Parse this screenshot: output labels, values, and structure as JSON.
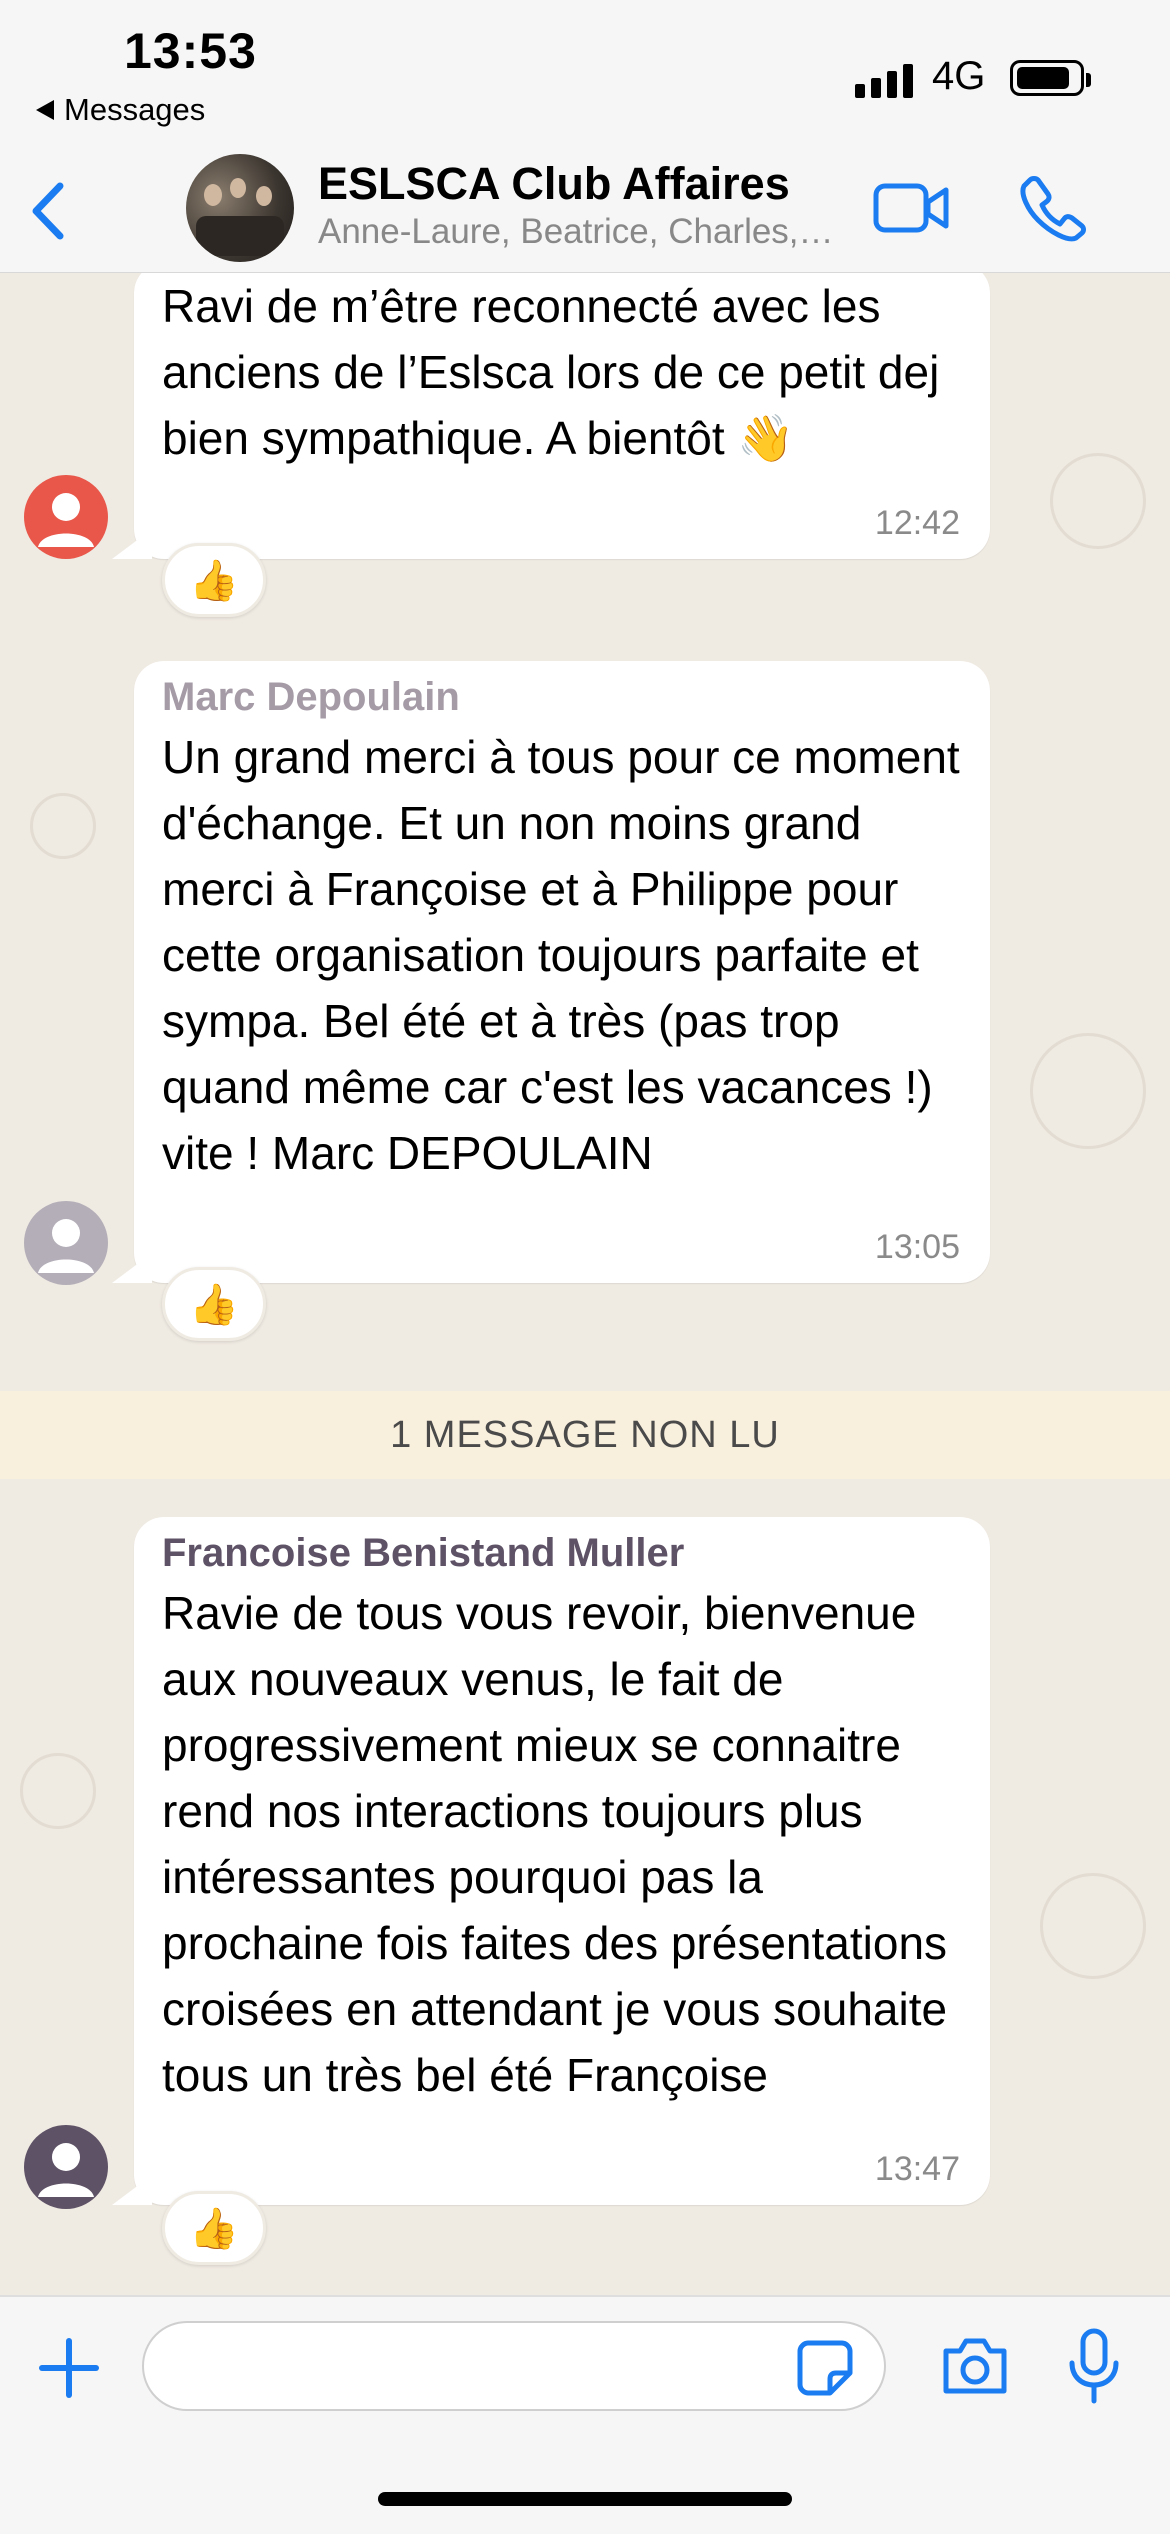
{
  "status_bar": {
    "time": "13:53",
    "back_app": "Messages",
    "network": "4G",
    "battery_level": 0.86
  },
  "header": {
    "group_name": "ESLSCA Club Affaires",
    "members": "Anne-Laure, Beatrice, Charles, Marc, Philippe",
    "back_icon": "chevron-left-icon",
    "video_icon": "video-camera-icon",
    "call_icon": "phone-icon",
    "accent_color": "#1a7cf0"
  },
  "messages": [
    {
      "sender": "",
      "text": "Ravi de m’être reconnecté avec les anciens de l’Eslsca lors de ce petit dej bien sympathique. A bientôt 👋",
      "time": "12:42",
      "reaction": "👍",
      "avatar_color": "#e8574a"
    },
    {
      "sender": "Marc Depoulain",
      "sender_color": "#a59ba6",
      "text": "Un grand merci à tous pour ce moment d'échange. Et un non moins grand merci à Françoise et à Philippe pour cette organisation toujours parfaite et sympa. Bel été et à très (pas trop quand même car c'est les vacances !) vite ! Marc DEPOULAIN",
      "time": "13:05",
      "reaction": "👍",
      "avatar_color": "#b4aeb8"
    },
    {
      "sender": "Francoise Benistand Muller",
      "sender_color": "#5e5266",
      "text": "Ravie de tous vous revoir, bienvenue aux nouveaux venus, le fait de progressivement mieux se connaitre rend nos interactions toujours plus intéressantes pourquoi pas la prochaine fois faites des présentations croisées en attendant je vous souhaite tous un très bel été Françoise",
      "time": "13:47",
      "reaction": "👍",
      "avatar_color": "#5e5266"
    }
  ],
  "unread_banner": "1 MESSAGE NON LU",
  "composer": {
    "placeholder": "",
    "plus_icon": "plus-icon",
    "sticker_icon": "sticker-icon",
    "camera_icon": "camera-icon",
    "mic_icon": "microphone-icon"
  }
}
